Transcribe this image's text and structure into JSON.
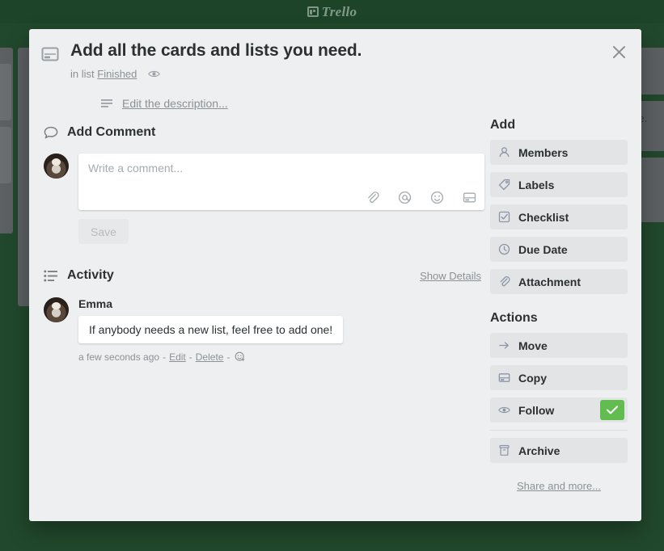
{
  "topbar": {
    "logo_text": "Trello",
    "logo_icon": "trello-board-icon"
  },
  "background": {
    "fragment_text": "ore.",
    "note": "dimmed board lists behind modal"
  },
  "modal": {
    "close_icon": "close-icon",
    "header": {
      "icon": "card-icon",
      "title": "Add all the cards and lists you need.",
      "in_list_prefix": "in list",
      "list_name": "Finished",
      "watch_icon": "eye-icon"
    },
    "description": {
      "icon": "description-lines-icon",
      "link_label": "Edit the description..."
    },
    "comment": {
      "section_icon": "speech-bubble-icon",
      "section_title": "Add Comment",
      "avatar": "user-avatar",
      "placeholder": "Write a comment...",
      "value": "",
      "icons": [
        "attachment-paperclip-icon",
        "mention-at-icon",
        "emoji-smiley-icon",
        "card-icon"
      ],
      "save_label": "Save"
    },
    "activity": {
      "section_icon": "activity-list-icon",
      "section_title": "Activity",
      "show_details_label": "Show Details",
      "entries": [
        {
          "avatar": "user-avatar",
          "author": "Emma",
          "text": "If anybody needs a new list, feel free to add one!",
          "timestamp": "a few seconds ago",
          "edit_label": "Edit",
          "delete_label": "Delete",
          "separator": "-",
          "react_icon": "add-reaction-icon"
        }
      ]
    },
    "sidebar": {
      "add_title": "Add",
      "add_items": [
        {
          "label": "Members",
          "icon": "member-person-icon"
        },
        {
          "label": "Labels",
          "icon": "label-tag-icon"
        },
        {
          "label": "Checklist",
          "icon": "checklist-checkbox-icon"
        },
        {
          "label": "Due Date",
          "icon": "clock-icon"
        },
        {
          "label": "Attachment",
          "icon": "attachment-paperclip-icon"
        }
      ],
      "actions_title": "Actions",
      "action_items": [
        {
          "label": "Move",
          "icon": "arrow-right-icon",
          "badge": false
        },
        {
          "label": "Copy",
          "icon": "card-icon",
          "badge": false
        },
        {
          "label": "Follow",
          "icon": "eye-icon",
          "badge": true,
          "badge_icon": "check-icon"
        },
        {
          "label": "Archive",
          "icon": "archive-box-icon",
          "badge": false
        }
      ],
      "share_label": "Share and more..."
    }
  },
  "colors": {
    "board_green": "#21482c",
    "topbar_green": "#1d4429",
    "modal_bg": "#edeff0",
    "button_bg": "#e2e4e6",
    "accent_green": "#61bd4f",
    "text_dark": "#2c3033",
    "text_muted": "#8c9196"
  }
}
